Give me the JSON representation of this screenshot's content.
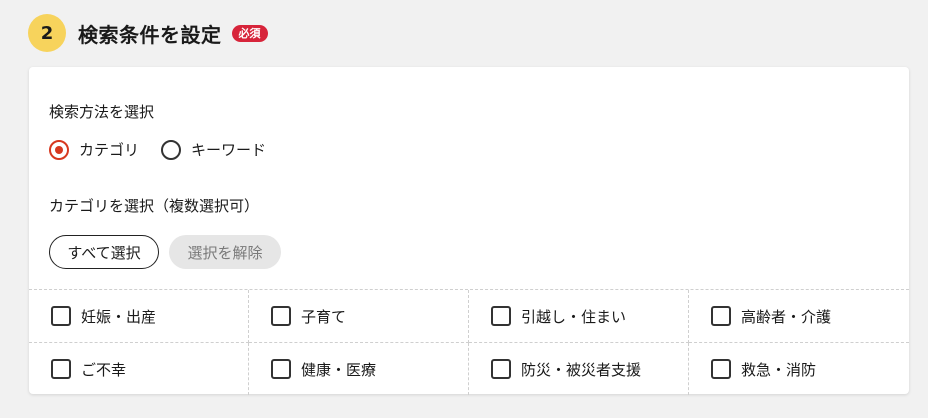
{
  "section": {
    "step_number": "2",
    "title": "検索条件を設定",
    "required_badge": "必須"
  },
  "search_method": {
    "label": "検索方法を選択",
    "options": [
      {
        "label": "カテゴリ",
        "selected": true
      },
      {
        "label": "キーワード",
        "selected": false
      }
    ]
  },
  "category": {
    "label": "カテゴリを選択（複数選択可）",
    "select_all_label": "すべて選択",
    "clear_label": "選択を解除",
    "items": [
      {
        "label": "妊娠・出産",
        "checked": false
      },
      {
        "label": "子育て",
        "checked": false
      },
      {
        "label": "引越し・住まい",
        "checked": false
      },
      {
        "label": "高齢者・介護",
        "checked": false
      },
      {
        "label": "ご不幸",
        "checked": false
      },
      {
        "label": "健康・医療",
        "checked": false
      },
      {
        "label": "防災・被災者支援",
        "checked": false
      },
      {
        "label": "救急・消防",
        "checked": false
      }
    ]
  },
  "colors": {
    "step_circle": "#f7d35c",
    "badge": "#d7243a",
    "radio_accent": "#d7381f"
  }
}
